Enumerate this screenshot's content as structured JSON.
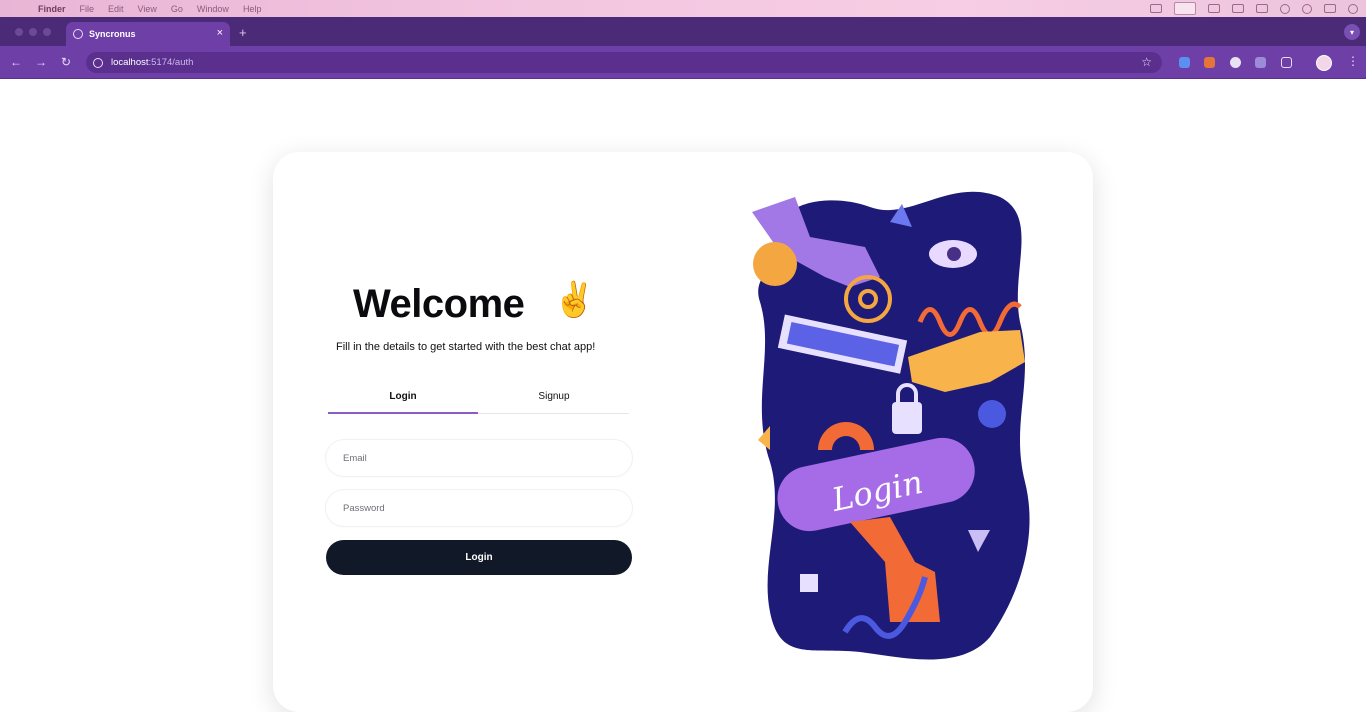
{
  "menubar": {
    "items": [
      "Finder",
      "File",
      "Edit",
      "View",
      "Go",
      "Window",
      "Help"
    ]
  },
  "browser": {
    "tab_title": "Syncronus",
    "tab_close": "×",
    "new_tab": "+",
    "url_host": "localhost",
    "url_path": ":5174/auth"
  },
  "page": {
    "heading": "Welcome",
    "emoji": "✌️",
    "subtitle": "Fill in the details to get started with the best chat app!",
    "tabs": [
      {
        "label": "Login",
        "active": true
      },
      {
        "label": "Signup",
        "active": false
      }
    ],
    "email_placeholder": "Email",
    "password_placeholder": "Password",
    "submit_label": "Login",
    "illustration_text": "Login"
  },
  "colors": {
    "accent": "#8b5cc4",
    "button": "#111827",
    "illustration_bg": "#1e1a78",
    "browser_chrome": "#6f3fa8"
  }
}
